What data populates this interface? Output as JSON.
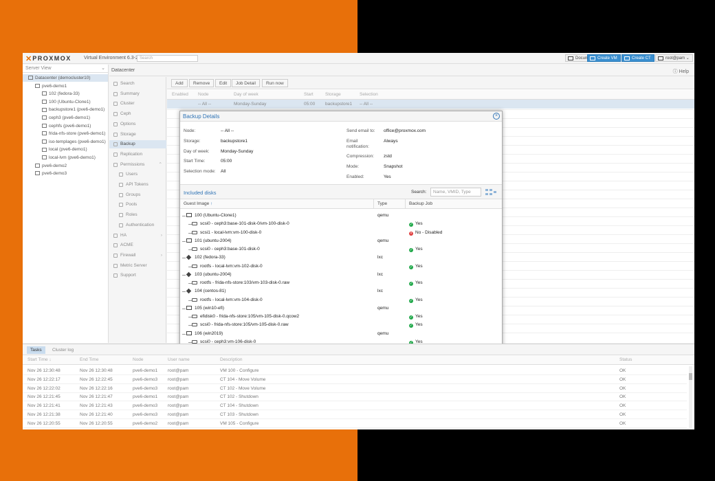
{
  "app": {
    "brand": "PROXMOX",
    "version": "Virtual Environment 6.3-2",
    "search_placeholder": "Search",
    "top_buttons": {
      "documentation": "Documentation",
      "create_vm": "Create VM",
      "create_ct": "Create CT",
      "user": "root@pam"
    }
  },
  "tree": {
    "header": "Server View",
    "items": [
      {
        "label": "Datacenter (democluster10)",
        "icon": "datacenter-icon",
        "level": 0
      },
      {
        "label": "pve6-demo1",
        "icon": "node-icon",
        "level": 1
      },
      {
        "label": "102 (fedora-33)",
        "icon": "container-icon",
        "level": 2
      },
      {
        "label": "100 (Ubuntu-Clone1)",
        "icon": "vm-icon",
        "level": 2
      },
      {
        "label": "backupstore1 (pve6-demo1)",
        "icon": "storage-icon",
        "level": 2
      },
      {
        "label": "ceph3 (pve6-demo1)",
        "icon": "storage-icon",
        "level": 2
      },
      {
        "label": "cephfs (pve6-demo1)",
        "icon": "storage-icon",
        "level": 2
      },
      {
        "label": "frida-nfs-store (pve6-demo1)",
        "icon": "storage-icon",
        "level": 2
      },
      {
        "label": "iso-templages (pve6-demo1)",
        "icon": "storage-icon",
        "level": 2
      },
      {
        "label": "local (pve6-demo1)",
        "icon": "storage-icon",
        "level": 2
      },
      {
        "label": "local-lvm (pve6-demo1)",
        "icon": "storage-icon",
        "level": 2
      },
      {
        "label": "pve6-demo2",
        "icon": "node-icon",
        "level": 1
      },
      {
        "label": "pve6-demo3",
        "icon": "node-icon",
        "level": 1
      }
    ]
  },
  "main": {
    "title": "Datacenter",
    "help": "Help",
    "menu": [
      {
        "label": "Search",
        "icon": "search-icon",
        "sub": false
      },
      {
        "label": "Summary",
        "icon": "summary-icon",
        "sub": false
      },
      {
        "label": "Cluster",
        "icon": "cluster-icon",
        "sub": false
      },
      {
        "label": "Ceph",
        "icon": "ceph-icon",
        "sub": false
      },
      {
        "label": "Options",
        "icon": "gear-icon",
        "sub": false
      },
      {
        "label": "Storage",
        "icon": "storage-icon",
        "sub": false
      },
      {
        "label": "Backup",
        "icon": "backup-icon",
        "sub": false
      },
      {
        "label": "Replication",
        "icon": "replication-icon",
        "sub": false
      },
      {
        "label": "Permissions",
        "icon": "lock-icon",
        "sub": false
      },
      {
        "label": "Users",
        "icon": "user-icon",
        "sub": true
      },
      {
        "label": "API Tokens",
        "icon": "token-icon",
        "sub": true
      },
      {
        "label": "Groups",
        "icon": "users-icon",
        "sub": true
      },
      {
        "label": "Pools",
        "icon": "tags-icon",
        "sub": true
      },
      {
        "label": "Roles",
        "icon": "male-icon",
        "sub": true
      },
      {
        "label": "Authentication",
        "icon": "key-icon",
        "sub": true
      },
      {
        "label": "HA",
        "icon": "heartbeat-icon",
        "sub": false
      },
      {
        "label": "ACME",
        "icon": "certificate-icon",
        "sub": false
      },
      {
        "label": "Firewall",
        "icon": "shield-icon",
        "sub": false
      },
      {
        "label": "Metric Server",
        "icon": "bar-chart-icon",
        "sub": false
      },
      {
        "label": "Support",
        "icon": "support-icon",
        "sub": false
      }
    ],
    "toolbar": {
      "add": "Add",
      "remove": "Remove",
      "edit": "Edit",
      "job_detail": "Job Detail",
      "run_now": "Run now"
    },
    "columns": [
      "Enabled",
      "Node",
      "Day of week",
      "Start",
      "Storage",
      "Selection"
    ],
    "row": {
      "node": "-- All --",
      "day": "Monday-Sunday",
      "start": "05:00",
      "storage": "backupstore1",
      "selection": "-- All --"
    }
  },
  "modal": {
    "title": "Backup Details",
    "left": [
      {
        "label": "Node:",
        "value": "-- All --"
      },
      {
        "label": "Storage:",
        "value": "backupstore1"
      },
      {
        "label": "Day of week:",
        "value": "Monday-Sunday"
      },
      {
        "label": "Start Time:",
        "value": "05:00"
      },
      {
        "label": "Selection mode:",
        "value": "All"
      }
    ],
    "right": [
      {
        "label": "Send email to:",
        "value": "office@proxmox.com"
      },
      {
        "label": "Email",
        "label2": "notification:",
        "value": "Always"
      },
      {
        "label": "Compression:",
        "value": "zstd"
      },
      {
        "label": "Mode:",
        "value": "Snapshot"
      },
      {
        "label": "Enabled:",
        "value": "Yes"
      }
    ],
    "included_title": "Included disks",
    "search_label": "Search:",
    "search_placeholder": "Name, VMID, Type",
    "columns": {
      "guest": "Guest Image",
      "sort_arrow": "↑",
      "type": "Type",
      "job": "Backup Job"
    },
    "rows": [
      {
        "kind": "vm",
        "name": "100 (Ubuntu-Clone1)",
        "type": "qemu",
        "job": ""
      },
      {
        "kind": "disk",
        "name": "scsi0 - ceph3:base-101-disk-0/vm-100-disk-0",
        "type": "",
        "job": "Yes",
        "status": "ok"
      },
      {
        "kind": "disk",
        "name": "scsi1 - local-lvm:vm-100-disk-0",
        "type": "",
        "job": "No - Disabled",
        "status": "no"
      },
      {
        "kind": "vm",
        "name": "101 (ubuntu-2004)",
        "type": "qemu",
        "job": ""
      },
      {
        "kind": "disk",
        "name": "scsi0 - ceph3:base-101-disk-0",
        "type": "",
        "job": "Yes",
        "status": "ok"
      },
      {
        "kind": "ct",
        "name": "102 (fedora-33)",
        "type": "lxc",
        "job": ""
      },
      {
        "kind": "disk",
        "name": "rootfs - local-lvm:vm-102-disk-0",
        "type": "",
        "job": "Yes",
        "status": "ok"
      },
      {
        "kind": "ct",
        "name": "103 (ubuntu-2004)",
        "type": "lxc",
        "job": ""
      },
      {
        "kind": "disk",
        "name": "rootfs - frida-nfs-store:103/vm-103-disk-0.raw",
        "type": "",
        "job": "Yes",
        "status": "ok"
      },
      {
        "kind": "ct",
        "name": "104 (centos-81)",
        "type": "lxc",
        "job": ""
      },
      {
        "kind": "disk",
        "name": "rootfs - local-lvm:vm-104-disk-0",
        "type": "",
        "job": "Yes",
        "status": "ok"
      },
      {
        "kind": "vm",
        "name": "105 (win10-efi)",
        "type": "qemu",
        "job": ""
      },
      {
        "kind": "disk",
        "name": "efidisk0 - frida-nfs-store:105/vm-105-disk-0.qcow2",
        "type": "",
        "job": "Yes",
        "status": "ok"
      },
      {
        "kind": "disk",
        "name": "scsi0 - frida-nfs-store:105/vm-105-disk-0.raw",
        "type": "",
        "job": "Yes",
        "status": "ok"
      },
      {
        "kind": "vm",
        "name": "106 (win2019)",
        "type": "qemu",
        "job": ""
      },
      {
        "kind": "disk",
        "name": "scsi0 - ceph3:vm-106-disk-0",
        "type": "",
        "job": "Yes",
        "status": "ok"
      }
    ]
  },
  "tasks": {
    "tabs": [
      "Tasks",
      "Cluster log"
    ],
    "columns": [
      "Start Time",
      "End Time",
      "Node",
      "User name",
      "Description",
      "Status"
    ],
    "rows": [
      {
        "start": "Nov 26 12:30:48",
        "end": "Nov 26 12:30:48",
        "node": "pve6-demo1",
        "user": "root@pam",
        "desc": "VM 100 - Configure",
        "status": "OK"
      },
      {
        "start": "Nov 26 12:22:17",
        "end": "Nov 26 12:22:45",
        "node": "pve6-demo3",
        "user": "root@pam",
        "desc": "CT 104 - Move Volume",
        "status": "OK"
      },
      {
        "start": "Nov 26 12:22:02",
        "end": "Nov 26 12:22:16",
        "node": "pve6-demo3",
        "user": "root@pam",
        "desc": "CT 102 - Move Volume",
        "status": "OK"
      },
      {
        "start": "Nov 26 12:21:45",
        "end": "Nov 26 12:21:47",
        "node": "pve6-demo1",
        "user": "root@pam",
        "desc": "CT 102 - Shutdown",
        "status": "OK"
      },
      {
        "start": "Nov 26 12:21:41",
        "end": "Nov 26 12:21:43",
        "node": "pve6-demo3",
        "user": "root@pam",
        "desc": "CT 104 - Shutdown",
        "status": "OK"
      },
      {
        "start": "Nov 26 12:21:38",
        "end": "Nov 26 12:21:40",
        "node": "pve6-demo3",
        "user": "root@pam",
        "desc": "CT 103 - Shutdown",
        "status": "OK"
      },
      {
        "start": "Nov 26 12:20:55",
        "end": "Nov 26 12:20:55",
        "node": "pve6-demo2",
        "user": "root@pam",
        "desc": "VM 105 - Configure",
        "status": "OK"
      }
    ]
  },
  "colors": {
    "accent": "#2f73b5",
    "brand": "#e57000",
    "selection": "#dbe6f1",
    "ok": "#21a84a",
    "error": "#e04040"
  }
}
